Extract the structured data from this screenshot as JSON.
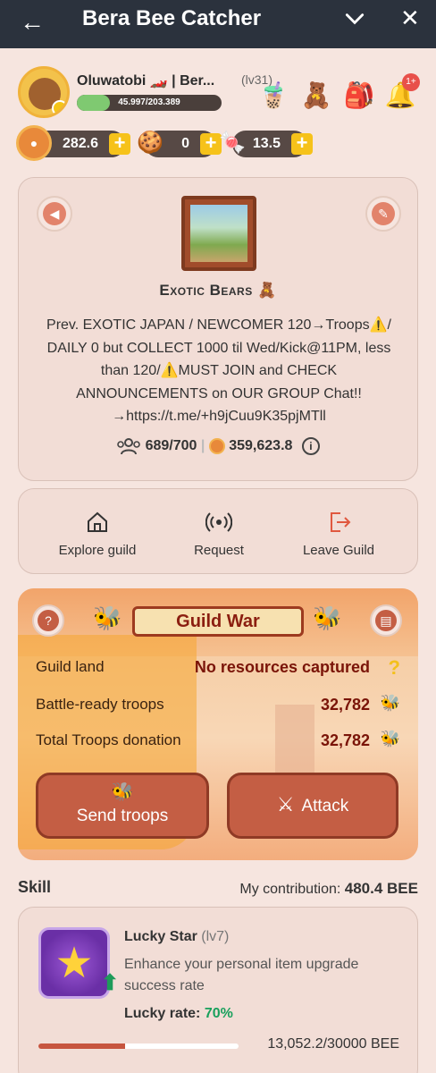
{
  "topbar": {
    "title": "Bera Bee Catcher"
  },
  "profile": {
    "name": "Oluwatobi 🏎️ | Ber...",
    "level": "(lv31)",
    "xp_text": "45.997/203.389",
    "xp_fraction": 0.226,
    "notification_count": "1+"
  },
  "currencies": [
    {
      "icon": "honey-coin-icon",
      "value": "282.6"
    },
    {
      "icon": "cookie-icon",
      "value": "0"
    },
    {
      "icon": "candy-icon",
      "value": "13.5"
    }
  ],
  "guild": {
    "name": "Exotic Bears 🧸",
    "description": "Prev. EXOTIC JAPAN / NEWCOMER 120→Troops⚠️/ DAILY 0 but COLLECT 1000 til Wed/Kick@11PM, less than 120/⚠️MUST JOIN and CHECK ANNOUNCEMENTS on OUR GROUP Chat!!→https://t.me/+h9jCuu9K35pjMTll",
    "members": "689/700",
    "treasury": "359,623.8"
  },
  "actions": {
    "explore": "Explore guild",
    "request": "Request",
    "leave": "Leave Guild"
  },
  "war": {
    "title": "Guild War",
    "land_label": "Guild land",
    "land_value": "No resources captured",
    "troops_label": "Battle-ready troops",
    "troops_value": "32,782",
    "donation_label": "Total Troops donation",
    "donation_value": "32,782",
    "send_label": "Send troops",
    "attack_label": "Attack"
  },
  "skill": {
    "heading": "Skill",
    "contribution_label": "My contribution:",
    "contribution_value": "480.4 BEE",
    "name": "Lucky Star",
    "level": "(lv7)",
    "description": "Enhance your personal item upgrade success rate",
    "rate_label": "Lucky rate:",
    "rate_value": "70%",
    "progress_text": "13,052.2/30000 BEE",
    "progress_fraction": 0.435
  },
  "colors": {
    "topbar": "#2b323d",
    "accent": "#c45e44",
    "background": "#f6e5df",
    "success": "#19a05c"
  }
}
